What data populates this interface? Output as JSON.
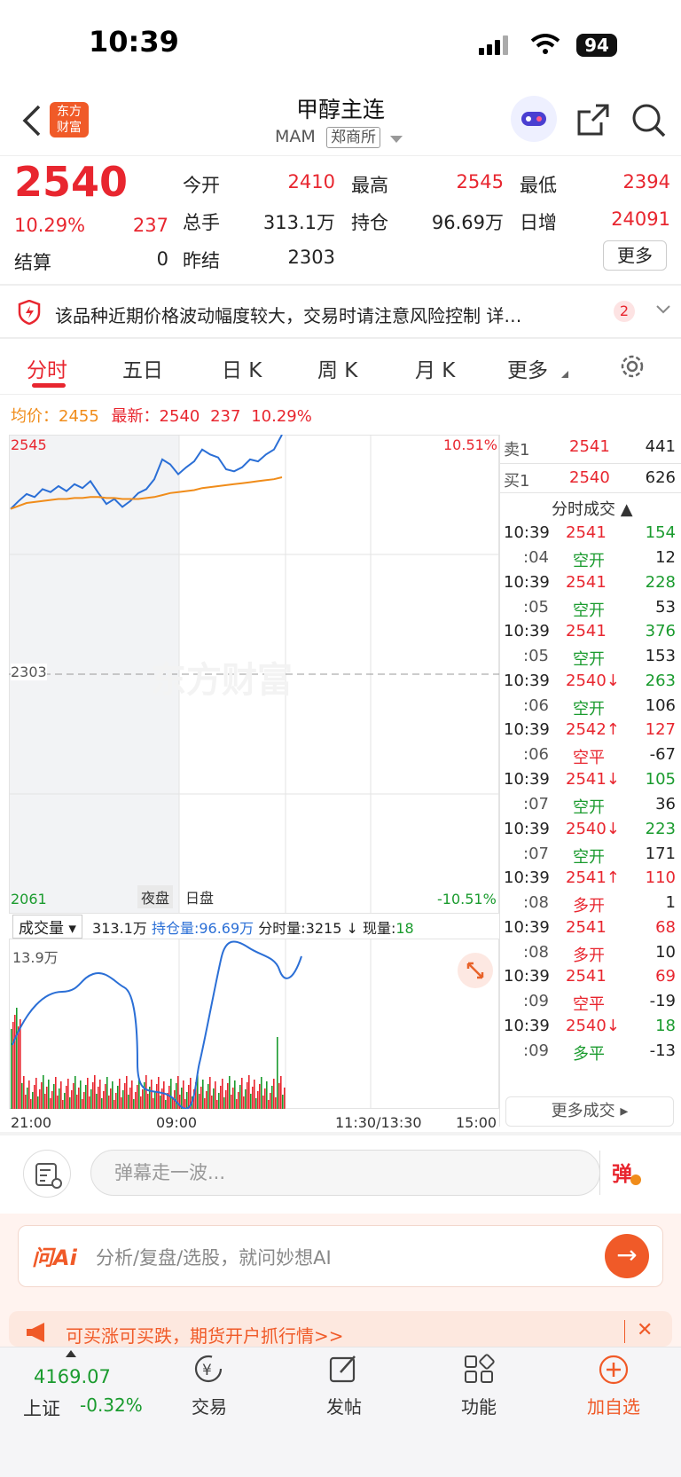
{
  "status": {
    "time": "10:39",
    "battery": "94"
  },
  "header": {
    "title": "甲醇主连",
    "code": "MAM",
    "exchange": "郑商所",
    "logo_text": "东方\n财富"
  },
  "quote": {
    "price": "2540",
    "change_pct": "10.29%",
    "change": "237",
    "open_label": "今开",
    "open": "2410",
    "high_label": "最高",
    "high": "2545",
    "low_label": "最低",
    "low": "2394",
    "volume_label": "总手",
    "volume": "313.1万",
    "oi_label": "持仓",
    "oi": "96.69万",
    "daily_inc_label": "日增",
    "daily_inc": "24091",
    "settle_label": "结算",
    "settle": "0",
    "prev_settle_label": "昨结",
    "prev_settle": "2303",
    "more": "更多"
  },
  "alert": {
    "text": "该品种近期价格波动幅度较大，交易时请注意风险控制 详…",
    "badge": "2"
  },
  "tabs": [
    "分时",
    "五日",
    "日 K",
    "周 K",
    "月 K",
    "更多"
  ],
  "infoline": {
    "avg_label": "均价：",
    "avg": "2455",
    "last_label": "最新：",
    "last": "2540",
    "chg": "237",
    "pct": "10.29%"
  },
  "chart": {
    "y_top": "2545",
    "y_mid": "2303",
    "y_bottom": "2061",
    "pct_top": "10.51%",
    "pct_bottom": "-10.51%",
    "session_night": "夜盘",
    "session_day": "日盘",
    "watermark": "东方财富",
    "time_labels": [
      "21:00",
      "09:00",
      "11:30/13:30",
      "15:00"
    ]
  },
  "chart_data": {
    "type": "line",
    "series": [
      {
        "name": "最新",
        "values": [
          2470,
          2478,
          2485,
          2482,
          2490,
          2487,
          2493,
          2488,
          2495,
          2491,
          2498,
          2486,
          2475,
          2480,
          2472,
          2478,
          2486,
          2490,
          2500,
          2520,
          2515,
          2505,
          2512,
          2518,
          2530,
          2525,
          2522,
          2510,
          2508,
          2512,
          2520,
          2518,
          2525,
          2530,
          2545
        ]
      },
      {
        "name": "均价",
        "values": [
          2470,
          2473,
          2476,
          2477,
          2478,
          2479,
          2480,
          2480,
          2481,
          2481,
          2482,
          2482,
          2481,
          2481,
          2480,
          2480,
          2480,
          2481,
          2482,
          2484,
          2486,
          2487,
          2488,
          2489,
          2491,
          2492,
          2493,
          2494,
          2495,
          2496,
          2497,
          2498,
          2499,
          2500,
          2502
        ]
      }
    ],
    "ylim": [
      2061,
      2545
    ]
  },
  "volume": {
    "selector": "成交量",
    "total": "313.1万",
    "oi_label": "持仓量:",
    "oi": "96.69万",
    "tick_label": "分时量:",
    "tick": "3215 ↓",
    "now_label": "现量:",
    "now": "18",
    "ymax": "13.9万"
  },
  "book": {
    "sell_label": "卖1",
    "sell_price": "2541",
    "sell_vol": "441",
    "buy_label": "买1",
    "buy_price": "2540",
    "buy_vol": "626",
    "trades_title": "分时成交 ▲",
    "more_trades": "更多成交 ▸"
  },
  "trades": [
    {
      "t": "10:39",
      "p": "2541",
      "v": "154",
      "s": ":04",
      "k": "空开",
      "n": "12",
      "pc": "red",
      "vc": "green",
      "kc": "green"
    },
    {
      "t": "10:39",
      "p": "2541",
      "v": "228",
      "s": ":05",
      "k": "空开",
      "n": "53",
      "pc": "red",
      "vc": "green",
      "kc": "green"
    },
    {
      "t": "10:39",
      "p": "2541",
      "v": "376",
      "s": ":05",
      "k": "空开",
      "n": "153",
      "pc": "red",
      "vc": "green",
      "kc": "green"
    },
    {
      "t": "10:39",
      "p": "2540↓",
      "v": "263",
      "s": ":06",
      "k": "空开",
      "n": "106",
      "pc": "red",
      "vc": "green",
      "kc": "green"
    },
    {
      "t": "10:39",
      "p": "2542↑",
      "v": "127",
      "s": ":06",
      "k": "空平",
      "n": "-67",
      "pc": "red",
      "vc": "red",
      "kc": "red"
    },
    {
      "t": "10:39",
      "p": "2541↓",
      "v": "105",
      "s": ":07",
      "k": "空开",
      "n": "36",
      "pc": "red",
      "vc": "green",
      "kc": "green"
    },
    {
      "t": "10:39",
      "p": "2540↓",
      "v": "223",
      "s": ":07",
      "k": "空开",
      "n": "171",
      "pc": "red",
      "vc": "green",
      "kc": "green"
    },
    {
      "t": "10:39",
      "p": "2541↑",
      "v": "110",
      "s": ":08",
      "k": "多开",
      "n": "1",
      "pc": "red",
      "vc": "red",
      "kc": "red"
    },
    {
      "t": "10:39",
      "p": "2541",
      "v": "68",
      "s": ":08",
      "k": "多开",
      "n": "10",
      "pc": "red",
      "vc": "red",
      "kc": "red"
    },
    {
      "t": "10:39",
      "p": "2541",
      "v": "69",
      "s": ":09",
      "k": "空平",
      "n": "-19",
      "pc": "red",
      "vc": "red",
      "kc": "red"
    },
    {
      "t": "10:39",
      "p": "2540↓",
      "v": "18",
      "s": ":09",
      "k": "多平",
      "n": "-13",
      "pc": "red",
      "vc": "green",
      "kc": "green"
    }
  ],
  "comment": {
    "placeholder": "弹幕走一波...",
    "danmu": "弹"
  },
  "ai": {
    "logo": "问Ai",
    "text": "分析/复盘/选股，就问妙想AI"
  },
  "ad": {
    "text": "可买涨可买跌，期货开户抓行情>>"
  },
  "nav": {
    "index_value": "4169.07",
    "index_name": "上证",
    "index_pct": "-0.32%",
    "trade": "交易",
    "post": "发帖",
    "func": "功能",
    "add": "加自选"
  }
}
